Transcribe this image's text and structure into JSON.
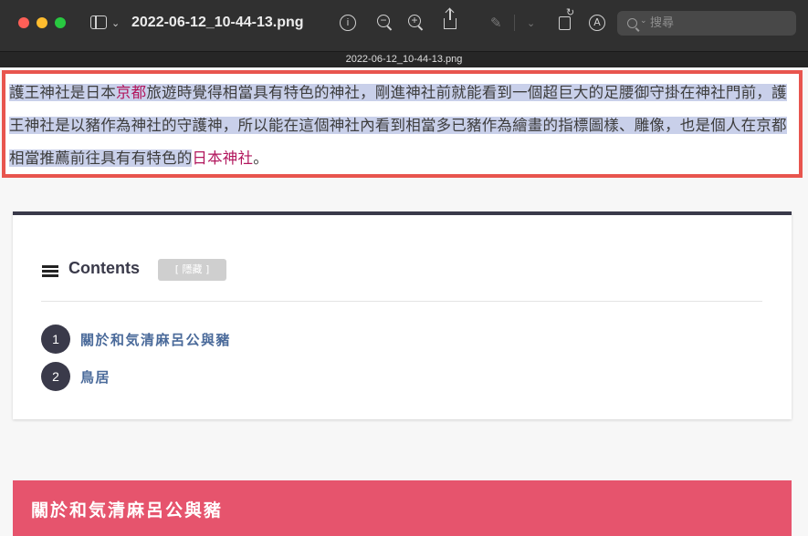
{
  "window": {
    "title": "2022-06-12_10-44-13.png",
    "tab_filename": "2022-06-12_10-44-13.png"
  },
  "toolbar": {
    "info_label": "i",
    "zoom_out_label": "−",
    "zoom_in_label": "+",
    "markup_label": "A",
    "search_placeholder": "搜尋"
  },
  "paragraph": {
    "p1": "護王神社是日本",
    "link1": "京都",
    "p2": "旅遊時覺得相當具有特色的神社，剛進神社前就能看到一個超巨大的足腰御守掛在神社門前，護王神社是以豬作為神社的守護神，所以能在這個神社內看到相當多已豬作為繪畫的指標圖樣、雕像，也是個人在京都相當推薦前往具有有特色的",
    "link2": "日本神社",
    "p3": "。"
  },
  "toc": {
    "title": "Contents",
    "toggle_label": "[ 隱藏 ]",
    "items": [
      {
        "num": "1",
        "label": "關於和気清麻呂公與豬"
      },
      {
        "num": "2",
        "label": "鳥居"
      }
    ]
  },
  "section": {
    "heading": "關於和気清麻呂公與豬"
  },
  "colors": {
    "selection_border": "#e8554e",
    "highlight": "#c9d0ea",
    "link": "#b2175d",
    "section_bar": "#e6546d",
    "toc_accent": "#3a3a4a"
  }
}
